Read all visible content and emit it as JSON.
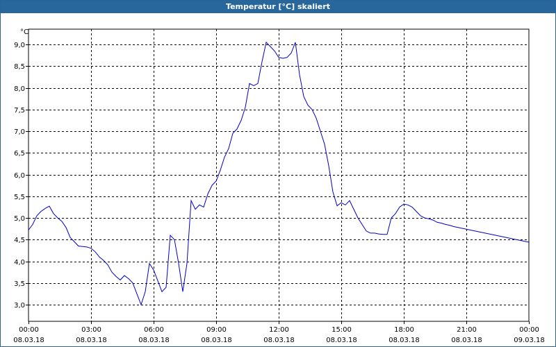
{
  "window": {
    "title": "Temperatur [°C] skaliert"
  },
  "chart_data": {
    "type": "line",
    "title": "Temperatur [°C] skaliert",
    "ylabel": "°C",
    "xlabel": "",
    "ylim": [
      2.8,
      9.4
    ],
    "yticks": [
      "9,0",
      "8,5",
      "8,0",
      "7,5",
      "7,0",
      "6,5",
      "6,0",
      "5,5",
      "5,0",
      "4,5",
      "4,0",
      "3,5",
      "3,0"
    ],
    "ytick_values": [
      9.0,
      8.5,
      8.0,
      7.5,
      7.0,
      6.5,
      6.0,
      5.5,
      5.0,
      4.5,
      4.0,
      3.5,
      3.0
    ],
    "xlim": [
      0,
      24
    ],
    "xticks": [
      {
        "time": "00:00",
        "date": "08.03.18"
      },
      {
        "time": "03:00",
        "date": "08.03.18"
      },
      {
        "time": "06:00",
        "date": "08.03.18"
      },
      {
        "time": "09:00",
        "date": "08.03.18"
      },
      {
        "time": "12:00",
        "date": "08.03.18"
      },
      {
        "time": "15:00",
        "date": "08.03.18"
      },
      {
        "time": "18:00",
        "date": "08.03.18"
      },
      {
        "time": "21:00",
        "date": "08.03.18"
      },
      {
        "time": "00:00",
        "date": "09.03.18"
      }
    ],
    "grid": true,
    "line_color": "#0000c8",
    "series": [
      {
        "x": [
          0,
          0.2,
          0.4,
          0.6,
          0.8,
          1.0,
          1.2,
          1.4,
          1.6,
          1.8,
          2.0,
          2.2,
          2.4,
          2.6,
          2.8,
          3.0,
          3.2,
          3.4,
          3.6,
          3.8,
          4.0,
          4.2,
          4.4,
          4.6,
          4.8,
          5.0,
          5.2,
          5.4,
          5.6,
          5.8,
          6.0,
          6.2,
          6.4,
          6.6,
          6.8,
          7.0,
          7.2,
          7.4,
          7.6,
          7.8,
          8.0,
          8.2,
          8.4,
          8.6,
          8.8,
          9.0,
          9.2,
          9.4,
          9.6,
          9.8,
          10.0,
          10.2,
          10.4,
          10.6,
          10.8,
          11.0,
          11.2,
          11.4,
          11.6,
          11.8,
          12.0,
          12.2,
          12.4,
          12.6,
          12.8,
          13.0,
          13.2,
          13.4,
          13.6,
          13.8,
          14.0,
          14.2,
          14.4,
          14.6,
          14.8,
          15.0,
          15.2,
          15.4,
          15.6,
          15.8,
          16.0,
          16.2,
          16.4,
          16.6,
          16.8,
          17.0,
          17.2,
          17.4,
          17.6,
          17.8,
          18.0,
          18.2,
          18.4,
          18.6,
          18.8,
          19.0,
          19.2,
          19.4,
          19.6,
          19.8,
          20.0,
          20.2,
          20.4,
          20.6,
          20.8,
          21.0,
          21.2,
          21.4,
          21.6,
          21.8,
          22.0,
          22.2,
          22.4,
          22.6,
          22.8,
          23.0,
          23.2,
          23.4,
          23.6,
          23.8,
          24.0
        ],
        "values": [
          4.72,
          4.85,
          5.05,
          5.15,
          5.22,
          5.27,
          5.1,
          5.0,
          4.92,
          4.78,
          4.55,
          4.45,
          4.35,
          4.34,
          4.33,
          4.3,
          4.22,
          4.1,
          4.02,
          3.92,
          3.75,
          3.65,
          3.57,
          3.67,
          3.6,
          3.5,
          3.25,
          3.0,
          3.3,
          3.95,
          3.8,
          3.55,
          3.3,
          3.4,
          4.6,
          4.5,
          3.95,
          3.3,
          3.95,
          5.4,
          5.2,
          5.3,
          5.25,
          5.55,
          5.75,
          5.85,
          6.1,
          6.4,
          6.6,
          6.95,
          7.05,
          7.25,
          7.55,
          8.1,
          8.05,
          8.1,
          8.6,
          9.05,
          8.95,
          8.85,
          8.7,
          8.68,
          8.7,
          8.8,
          9.05,
          8.3,
          7.8,
          7.6,
          7.5,
          7.3,
          7.0,
          6.7,
          6.2,
          5.6,
          5.28,
          5.35,
          5.3,
          5.4,
          5.2,
          5.0,
          4.85,
          4.7,
          4.65,
          4.65,
          4.63,
          4.62,
          4.62,
          5.0,
          5.1,
          5.25,
          5.32,
          5.3,
          5.25,
          5.15,
          5.05,
          5.0,
          4.98,
          4.95,
          4.9,
          4.88,
          4.85,
          4.83,
          4.8,
          4.78,
          4.76,
          4.74,
          4.72,
          4.7,
          4.68,
          4.66,
          4.64,
          4.62,
          4.6,
          4.58,
          4.56,
          4.54,
          4.52,
          4.5,
          4.48,
          4.46,
          4.44
        ]
      }
    ]
  }
}
